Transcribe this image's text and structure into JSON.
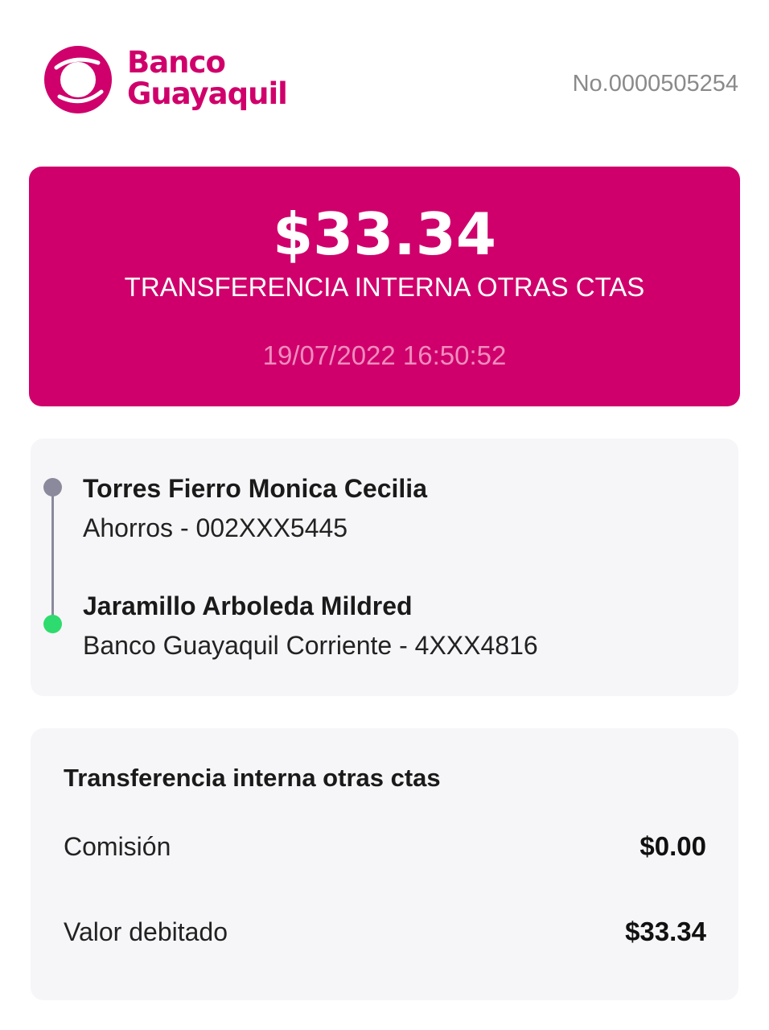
{
  "header": {
    "brand_line1": "Banco",
    "brand_line2": "Guayaquil",
    "receipt_number": "No.0000505254"
  },
  "summary": {
    "amount": "$33.34",
    "transaction_type": "TRANSFERENCIA INTERNA OTRAS CTAS",
    "datetime": "19/07/2022 16:50:52"
  },
  "parties": {
    "origin_name": "Torres Fierro Monica Cecilia",
    "origin_account": "Ahorros - 002XXX5445",
    "destination_name": "Jaramillo Arboleda Mildred",
    "destination_account": "Banco Guayaquil Corriente - 4XXX4816"
  },
  "details": {
    "title": "Transferencia interna otras ctas",
    "rows": [
      {
        "label": "Comisión",
        "value": "$0.00"
      },
      {
        "label": "Valor debitado",
        "value": "$33.34"
      }
    ]
  },
  "colors": {
    "brand": "#cf006b",
    "origin_dot": "#8a8a9c",
    "destination_dot": "#2edb6e"
  }
}
